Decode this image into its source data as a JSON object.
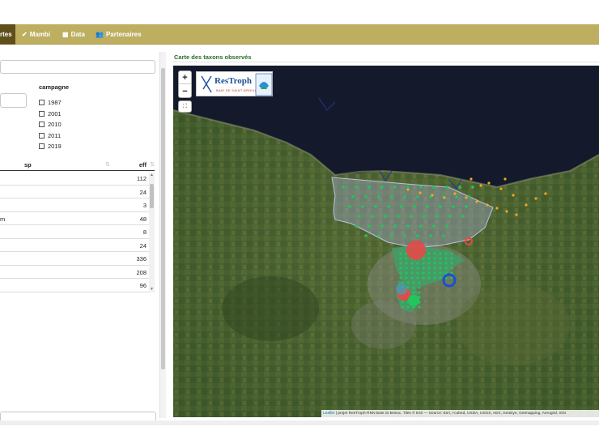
{
  "nav": {
    "items": [
      {
        "label": "rtes",
        "icon": "map-icon",
        "active": true
      },
      {
        "label": "Mambi",
        "icon": "check-icon",
        "active": false
      },
      {
        "label": "Data",
        "icon": "table-icon",
        "active": false
      },
      {
        "label": "Partenaires",
        "icon": "users-icon",
        "active": false
      }
    ]
  },
  "filters": {
    "campagne_title": "campagne",
    "campagnes": [
      "1987",
      "2001",
      "2010",
      "2011",
      "2019"
    ]
  },
  "table": {
    "col_sp": "sp",
    "col_eff": "eff",
    "rows": [
      {
        "sp": "",
        "eff": "112"
      },
      {
        "sp": "",
        "eff": "24"
      },
      {
        "sp": "",
        "eff": "3"
      },
      {
        "sp": "m",
        "eff": "48"
      },
      {
        "sp": "",
        "eff": "8"
      },
      {
        "sp": "",
        "eff": "24"
      },
      {
        "sp": "",
        "eff": "336"
      },
      {
        "sp": "",
        "eff": "208"
      },
      {
        "sp": "",
        "eff": "96"
      }
    ]
  },
  "map": {
    "title": "Carte des taxons observés",
    "zoom_in": "+",
    "zoom_out": "−",
    "fullscreen_icon": "fullscreen-icon",
    "logo_title": "ResTroph",
    "logo_subtitle": "BAIE DE SAINT-BRIEUC",
    "attribution_link": "Leaflet",
    "attribution_text": "| projet ResTroph-RNN Baie St Brieuc, Tiles © Esri — Source: Esri, i-cubed, USDA, USGS, AEX, GeoEye, Getmapping, Aerogrid, IGN"
  },
  "colors": {
    "navbar": "#bdae60",
    "nav_active": "#5f4f1a",
    "points_green": "#22c55e",
    "points_orange": "#f5a623",
    "points_red": "#ef4444",
    "points_blue": "#1d4ed8",
    "sea": "#141a2b"
  }
}
